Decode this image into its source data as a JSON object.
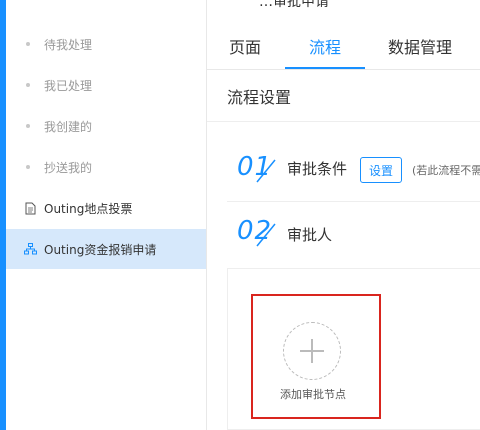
{
  "sidebar": {
    "items": [
      {
        "label": "待我处理"
      },
      {
        "label": "我已处理"
      },
      {
        "label": "我创建的"
      },
      {
        "label": "抄送我的"
      },
      {
        "label": "Outing地点投票",
        "icon": "document-icon"
      },
      {
        "label": "Outing资金报销申请",
        "icon": "org-chart-icon"
      }
    ]
  },
  "header": {
    "title_fragment": "…审批申请"
  },
  "tabs": [
    {
      "label": "页面"
    },
    {
      "label": "流程"
    },
    {
      "label": "数据管理"
    }
  ],
  "section": {
    "title": "流程设置"
  },
  "steps": [
    {
      "num": "01",
      "label": "审批条件",
      "button": "设置",
      "hint": "(若此流程不需"
    },
    {
      "num": "02",
      "label": "审批人"
    }
  ],
  "add_node": {
    "label": "添加审批节点"
  },
  "colors": {
    "accent": "#1890ff",
    "highlight": "#d9251e",
    "active_bg": "#d6e8fb"
  }
}
